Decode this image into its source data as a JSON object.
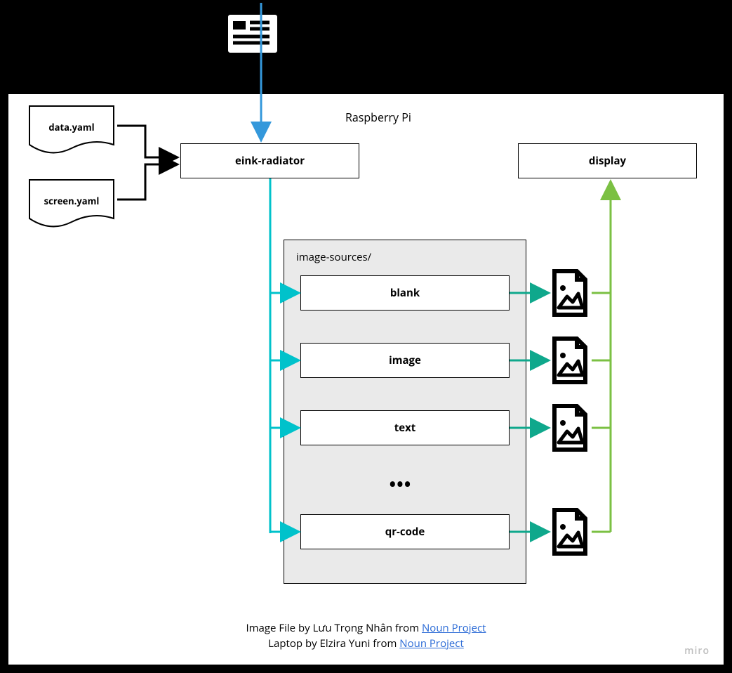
{
  "diagram": {
    "container_title": "Raspberry Pi",
    "files": {
      "data": "data.yaml",
      "screen": "screen.yaml"
    },
    "main_node": "eink-radiator",
    "display_node": "display",
    "sources": {
      "folder_label": "image-sources/",
      "items": {
        "blank": "blank",
        "image": "image",
        "text": "text",
        "ellipsis": "•••",
        "qr": "qr-code"
      }
    },
    "credits": {
      "line1_prefix": "Image File by Lưu Trọng Nhân from ",
      "line1_link": "Noun Project",
      "line2_prefix": "Laptop by Elzira Yuni from ",
      "line2_link": "Noun Project"
    },
    "watermark": "miro"
  }
}
